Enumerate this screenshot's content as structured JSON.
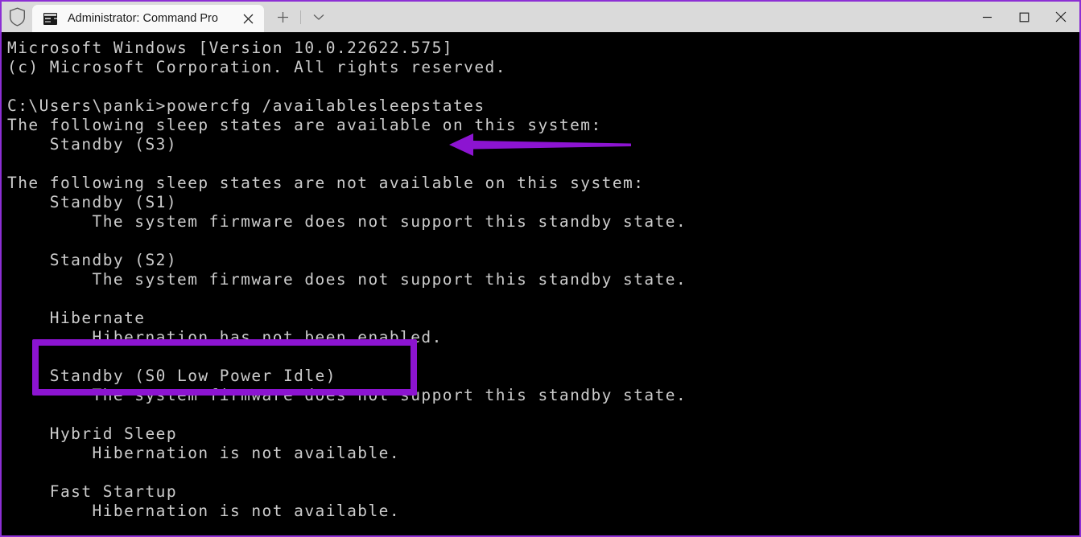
{
  "window": {
    "border_color": "#8c2fd4",
    "titlebar_bg": "#dadada",
    "terminal_bg": "#000000",
    "terminal_fg": "#cccccc"
  },
  "titlebar": {
    "shield_icon": "shield-icon",
    "tab": {
      "icon": "console-window-icon",
      "title": "Administrator: Command Pro",
      "close_icon": "close-icon"
    },
    "new_tab_icon": "plus-icon",
    "tab_menu_icon": "chevron-down-icon",
    "controls": {
      "minimize_icon": "minimize-icon",
      "maximize_icon": "maximize-icon",
      "close_icon": "close-icon"
    }
  },
  "terminal": {
    "text": "Microsoft Windows [Version 10.0.22622.575]\n(c) Microsoft Corporation. All rights reserved.\n\nC:\\Users\\panki>powercfg /availablesleepstates\nThe following sleep states are available on this system:\n    Standby (S3)\n\nThe following sleep states are not available on this system:\n    Standby (S1)\n        The system firmware does not support this standby state.\n\n    Standby (S2)\n        The system firmware does not support this standby state.\n\n    Hibernate\n        Hibernation has not been enabled.\n\n    Standby (S0 Low Power Idle)\n        The system firmware does not support this standby state.\n\n    Hybrid Sleep\n        Hibernation is not available.\n\n    Fast Startup\n        Hibernation is not available.",
    "prompt": "C:\\Users\\panki>",
    "command": "powercfg /availablesleepstates",
    "lines": [
      "Microsoft Windows [Version 10.0.22622.575]",
      "(c) Microsoft Corporation. All rights reserved.",
      "",
      "C:\\Users\\panki>powercfg /availablesleepstates",
      "The following sleep states are available on this system:",
      "    Standby (S3)",
      "",
      "The following sleep states are not available on this system:",
      "    Standby (S1)",
      "        The system firmware does not support this standby state.",
      "",
      "    Standby (S2)",
      "        The system firmware does not support this standby state.",
      "",
      "    Hibernate",
      "        Hibernation has not been enabled.",
      "",
      "    Standby (S0 Low Power Idle)",
      "        The system firmware does not support this standby state.",
      "",
      "    Hybrid Sleep",
      "        Hibernation is not available.",
      "",
      "    Fast Startup",
      "        Hibernation is not available."
    ]
  },
  "annotations": {
    "arrow": {
      "name": "pointer-arrow",
      "color": "#8c14d1",
      "points_to": "powercfg /availablesleepstates"
    },
    "highlight": {
      "name": "hibernate-highlight-box",
      "color": "#8c14d1",
      "surrounds": "Hibernate / Hibernation has not been enabled."
    }
  }
}
